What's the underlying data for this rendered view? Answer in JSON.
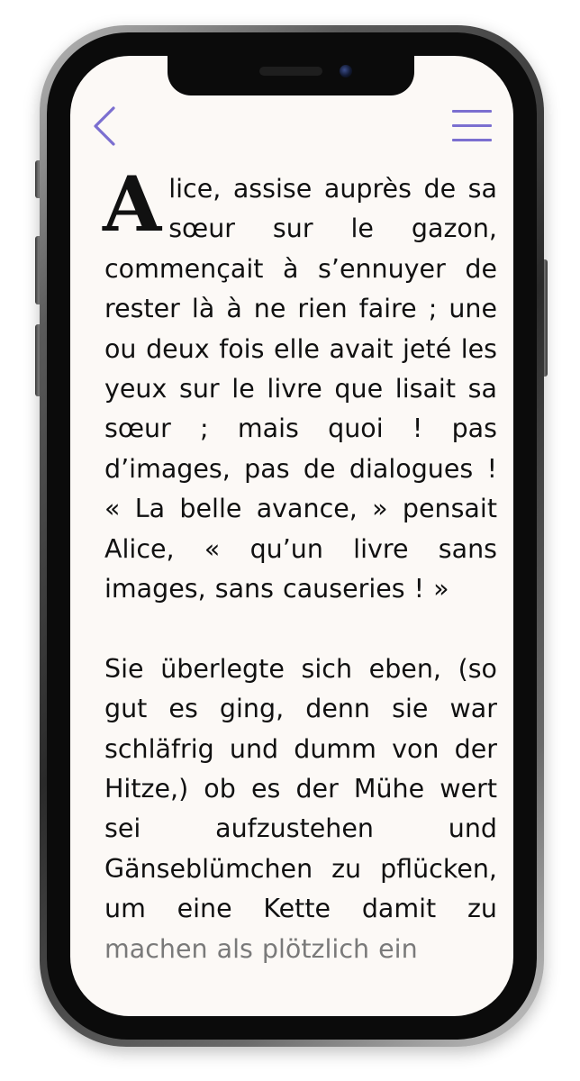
{
  "app": {
    "accent_color": "#7b6fd0",
    "page_background": "#fcf9f6",
    "text_color": "#111111"
  },
  "toolbar": {
    "back_icon": "chevron-left-icon",
    "menu_icon": "hamburger-menu-icon"
  },
  "reader": {
    "paragraphs": [
      {
        "drop_cap": "A",
        "text": "lice, assise auprès de sa sœur sur le gazon, commençait à s’ennuyer de rester là à ne rien faire ; une ou deux fois elle avait jeté les yeux sur le livre que lisait sa sœur ; mais quoi ! pas d’images, pas de dialogues ! « La belle avance, » pensait Alice, « qu’un livre sans images, sans causeries ! »"
      },
      {
        "text": "Sie überlegte sich eben, (so gut es ging, denn sie war schläfrig und dumm von der Hitze,) ob es der Mühe wert sei aufzustehen und Gänseblümchen zu pflücken, um eine Kette damit zu",
        "faded_text": "machen als plötzlich ein"
      }
    ]
  }
}
